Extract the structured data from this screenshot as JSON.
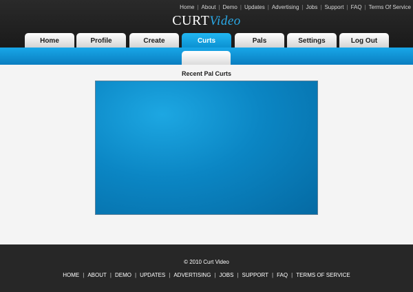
{
  "top_links": [
    "Home",
    "About",
    "Demo",
    "Updates",
    "Advertising",
    "Jobs",
    "Support",
    "FAQ",
    "Terms Of Service"
  ],
  "logo": {
    "main": "CURT",
    "sub": "Video"
  },
  "tabs": [
    {
      "label": "Home",
      "active": false
    },
    {
      "label": "Profile",
      "active": false
    },
    {
      "label": "Create",
      "active": false
    },
    {
      "label": "Curts",
      "active": true
    },
    {
      "label": "Pals",
      "active": false
    },
    {
      "label": "Settings",
      "active": false
    },
    {
      "label": "Log Out",
      "active": false
    }
  ],
  "content": {
    "title": "Recent Pal Curts"
  },
  "footer": {
    "copyright": "© 2010 Curt Video",
    "links": [
      "HOME",
      "ABOUT",
      "DEMO",
      "UPDATES",
      "ADVERTISING",
      "JOBS",
      "SUPPORT",
      "FAQ",
      "TERMS OF SERVICE"
    ]
  },
  "colors": {
    "accent": "#0a8fd0",
    "header_bg": "#222222",
    "footer_bg": "#272727"
  }
}
